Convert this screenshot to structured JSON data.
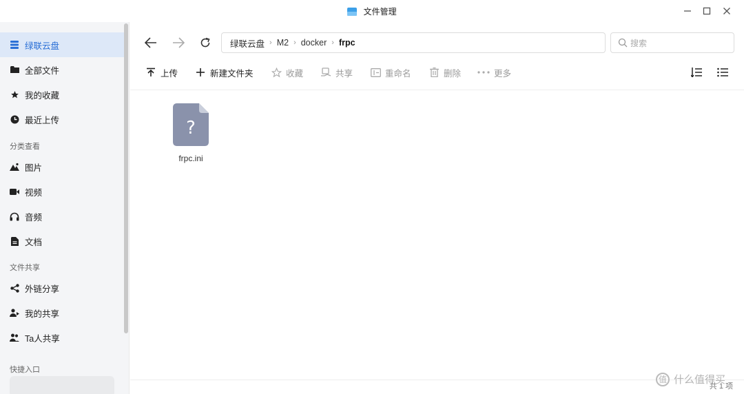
{
  "window": {
    "title": "文件管理"
  },
  "sidebar": {
    "items": [
      {
        "label": "绿联云盘",
        "icon": "storage-icon",
        "active": true
      },
      {
        "label": "全部文件",
        "icon": "folder-icon"
      },
      {
        "label": "我的收藏",
        "icon": "star-icon"
      },
      {
        "label": "最近上传",
        "icon": "clock-icon"
      }
    ],
    "section_category": "分类查看",
    "category_items": [
      {
        "label": "图片",
        "icon": "image-icon"
      },
      {
        "label": "视频",
        "icon": "video-icon"
      },
      {
        "label": "音频",
        "icon": "headphones-icon"
      },
      {
        "label": "文档",
        "icon": "document-icon"
      }
    ],
    "section_share": "文件共享",
    "share_items": [
      {
        "label": "外链分享",
        "icon": "share-icon"
      },
      {
        "label": "我的共享",
        "icon": "user-share-icon"
      },
      {
        "label": "Ta人共享",
        "icon": "users-icon"
      }
    ],
    "section_quick": "快捷入口"
  },
  "path": {
    "crumbs": [
      "绿联云盘",
      "M2",
      "docker"
    ],
    "current": "frpc"
  },
  "search": {
    "placeholder": "搜索"
  },
  "toolbar": {
    "upload": "上传",
    "new_folder": "新建文件夹",
    "favorite": "收藏",
    "share": "共享",
    "rename": "重命名",
    "delete": "删除",
    "more": "更多"
  },
  "files": [
    {
      "name": "frpc.ini",
      "icon": "unknown-file-icon"
    }
  ],
  "status": {
    "count": "共 1 项"
  },
  "watermark": {
    "text": "什么值得买",
    "icon": "值"
  },
  "colors": {
    "accent": "#2a6fd6",
    "active_bg": "#dde8f8",
    "file_icon": "#8a92ab"
  }
}
